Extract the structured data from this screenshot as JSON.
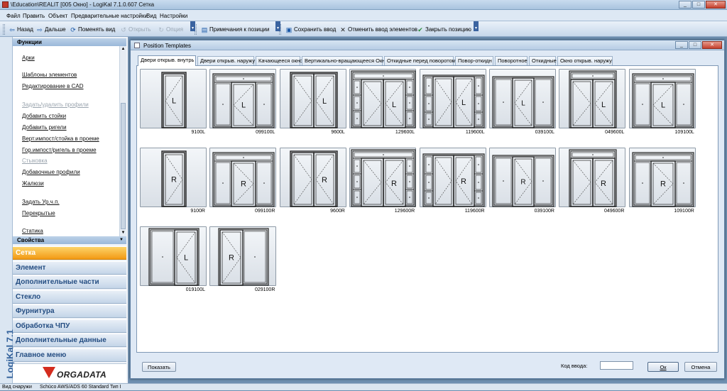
{
  "window": {
    "title": "\\Education\\REALIT [005 Окно] - LogiKal 7.1.0.607 Сетка",
    "buttons": {
      "minimize": "_",
      "maximize": "□",
      "close": "✕"
    }
  },
  "menu": [
    "Файл",
    "Править",
    "Объект",
    "Предварительные настройки",
    "Вид",
    "Настройки"
  ],
  "toolbar": {
    "back": "Назад",
    "forward": "Дальше",
    "change_view": "Поменять вид",
    "open": "Открыть",
    "option": "Опция",
    "notes": "Примечания к позиции",
    "save": "Сохранить ввод",
    "cancel_input": "Отменить ввод элементов",
    "close_position": "Закрыть позицию"
  },
  "left_panel": {
    "logo_vertical": "LogiKal 7.1",
    "functions_header": "Функции",
    "functions": [
      {
        "label": "Арки",
        "enabled": true
      },
      {
        "label": "Шаблоны элементов",
        "enabled": true
      },
      {
        "label": "Редактирование в CAD",
        "enabled": true
      },
      {
        "label": "Задать/удалить профили",
        "enabled": false
      },
      {
        "label": "Добавить стойки",
        "enabled": true
      },
      {
        "label": "Добавить ригели",
        "enabled": true
      },
      {
        "label": "Верт.импост/стойка в проеме",
        "enabled": true
      },
      {
        "label": "Гор.импост/ригель в проеме",
        "enabled": true
      },
      {
        "label": "Стыковка",
        "enabled": false
      },
      {
        "label": "Добавочные профили",
        "enabled": true
      },
      {
        "label": "Жалюзи",
        "enabled": true
      },
      {
        "label": "Задать Ур.ч.п.",
        "enabled": true
      },
      {
        "label": "Перекрытые",
        "enabled": true
      },
      {
        "label": "Статика",
        "enabled": true
      }
    ],
    "properties_header": "Свойства",
    "nav": [
      {
        "label": "Сетка",
        "active": true
      },
      {
        "label": "Элемент",
        "active": false
      },
      {
        "label": "Дополнительные части",
        "active": false
      },
      {
        "label": "Стекло",
        "active": false
      },
      {
        "label": "Фурнитура",
        "active": false
      },
      {
        "label": "Обработка ЧПУ",
        "active": false
      },
      {
        "label": "Дополнительные данные",
        "active": false
      },
      {
        "label": "Главное меню",
        "active": false
      }
    ],
    "company_logo": "ORGADATA"
  },
  "dialog": {
    "title": "Position Templates",
    "tabs": [
      "Двери открыв. внутрь",
      "Двери открыв. наружу",
      "Качающееся окно",
      "Вертикально-вращающееся Окно",
      "Откидные перед поворотом",
      "Повор-откидн",
      "Поворотное",
      "Откидные",
      "Окно открыв. наружу"
    ],
    "active_tab": 0,
    "templates": [
      {
        "code": "9100L",
        "kind": "single",
        "hand": "L"
      },
      {
        "code": "099100L",
        "kind": "side_transom",
        "hand": "L"
      },
      {
        "code": "9600L",
        "kind": "double",
        "hand": "L"
      },
      {
        "code": "129600L",
        "kind": "double_grid",
        "hand": "L"
      },
      {
        "code": "119600L",
        "kind": "double_sides",
        "hand": "L"
      },
      {
        "code": "039100L",
        "kind": "side_wide",
        "hand": "L"
      },
      {
        "code": "049600L",
        "kind": "double_transom",
        "hand": "L"
      },
      {
        "code": "109100L",
        "kind": "side_transom",
        "hand": "L"
      },
      {
        "code": "9100R",
        "kind": "single",
        "hand": "R"
      },
      {
        "code": "099100R",
        "kind": "side_transom",
        "hand": "R"
      },
      {
        "code": "9600R",
        "kind": "double",
        "hand": "R"
      },
      {
        "code": "129600R",
        "kind": "double_grid",
        "hand": "R"
      },
      {
        "code": "119600R",
        "kind": "double_sides",
        "hand": "R"
      },
      {
        "code": "039100R",
        "kind": "side_wide",
        "hand": "R"
      },
      {
        "code": "049600R",
        "kind": "double_transom",
        "hand": "R"
      },
      {
        "code": "109100R",
        "kind": "side_transom",
        "hand": "R"
      },
      {
        "code": "019100L",
        "kind": "one_side",
        "hand": "L"
      },
      {
        "code": "029100R",
        "kind": "one_side",
        "hand": "R"
      }
    ],
    "show_button": "Показать",
    "code_label": "Код ввода:",
    "code_value": "",
    "ok_button": "Ок",
    "cancel_button": "Отмена"
  },
  "status": {
    "view": "Вид снаружи",
    "system": "Schüco AWS/ADS 60 Standard Тип I"
  }
}
